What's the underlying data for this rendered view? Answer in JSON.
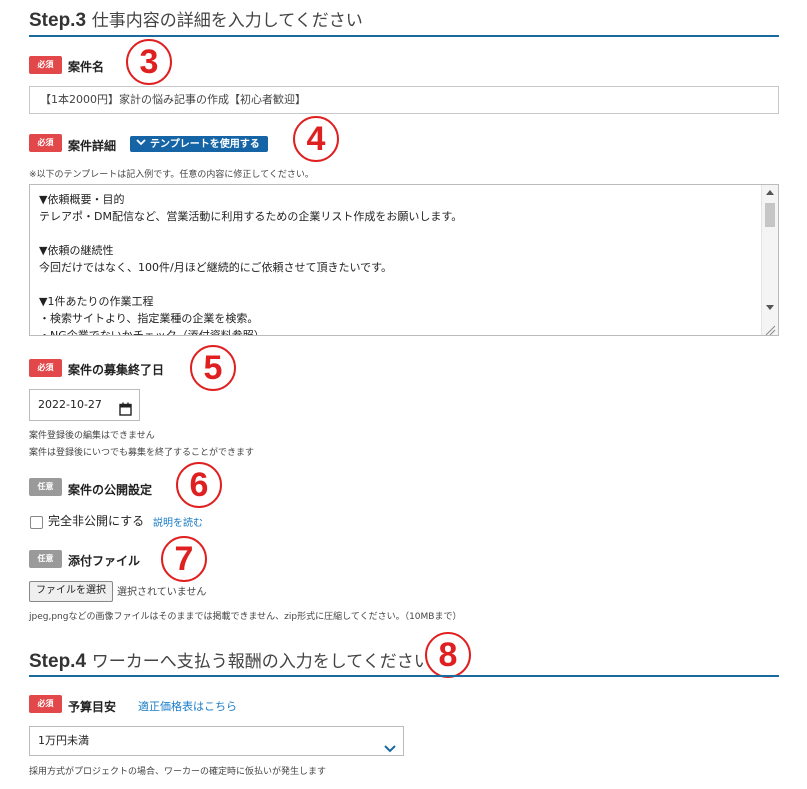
{
  "step3": {
    "prefix": "Step.3",
    "title": "仕事内容の詳細を入力してください",
    "annotations": [
      "3",
      "4",
      "5",
      "6",
      "7"
    ]
  },
  "badges": {
    "required": "必須",
    "optional": "任意"
  },
  "job_name": {
    "label": "案件名",
    "value": "【1本2000円】家計の悩み記事の作成【初心者歓迎】"
  },
  "job_detail": {
    "label": "案件詳細",
    "template_button": "テンプレートを使用する",
    "note": "※以下のテンプレートは記入例です。任意の内容に修正してください。",
    "text": "▼依頼概要・目的\nテレアポ・DM配信など、営業活動に利用するための企業リスト作成をお願いします。\n\n▼依頼の継続性\n今回だけではなく、100件/月ほど継続的にご依頼させて頂きたいです。\n\n▼1件あたりの作業工程\n・検索サイトより、指定業種の企業を検索。\n・NG企業でないかチェック（添付資料参照）"
  },
  "deadline": {
    "label": "案件の募集終了日",
    "value": "2022-10-27",
    "note1": "案件登録後の編集はできません",
    "note2": "案件は登録後にいつでも募集を終了することができます"
  },
  "visibility": {
    "label": "案件の公開設定",
    "checkbox_label": "完全非公開にする",
    "link": "説明を読む"
  },
  "attachment": {
    "label": "添付ファイル",
    "button": "ファイルを選択",
    "status": "選択されていません",
    "note": "jpeg,pngなどの画像ファイルはそのままでは掲載できません、zip形式に圧縮してください。（10MBまで）"
  },
  "step4": {
    "prefix": "Step.4",
    "title": "ワーカーへ支払う報酬の入力をしてください",
    "annotation": "8"
  },
  "budget": {
    "label": "予算目安",
    "link": "適正価格表はこちら",
    "selected": "1万円未満",
    "note": "採用方式がプロジェクトの場合、ワーカーの確定時に仮払いが発生します"
  },
  "colors": {
    "accent": "#1a6aa0",
    "required": "#e2474a",
    "optional": "#9a9a9a",
    "annotation": "#e02020",
    "link": "#1a7cc8"
  }
}
